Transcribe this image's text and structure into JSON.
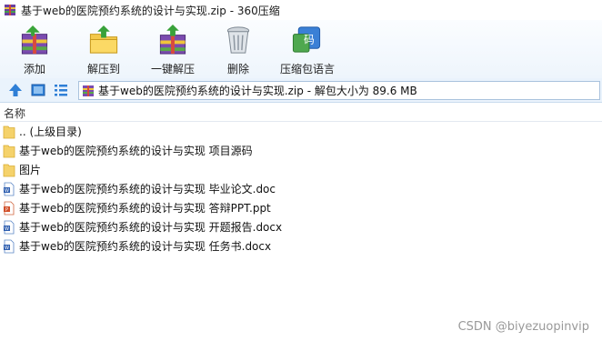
{
  "window": {
    "title": "基于web的医院预约系统的设计与实现.zip - 360压缩"
  },
  "toolbar": {
    "add": "添加",
    "extract_to": "解压到",
    "one_click_extract": "一键解压",
    "delete": "删除",
    "compress_language": "压缩包语言"
  },
  "address": {
    "path": "基于web的医院预约系统的设计与实现.zip - 解包大小为 89.6 MB"
  },
  "list": {
    "column_name": "名称",
    "items": [
      {
        "name": ".. (上级目录)",
        "type": "folder"
      },
      {
        "name": "基于web的医院预约系统的设计与实现 项目源码",
        "type": "folder"
      },
      {
        "name": "图片",
        "type": "folder"
      },
      {
        "name": "基于web的医院预约系统的设计与实现 毕业论文.doc",
        "type": "doc"
      },
      {
        "name": "基于web的医院预约系统的设计与实现 答辩PPT.ppt",
        "type": "ppt"
      },
      {
        "name": "基于web的医院预约系统的设计与实现 开题报告.docx",
        "type": "doc"
      },
      {
        "name": "基于web的医院预约系统的设计与实现 任务书.docx",
        "type": "doc"
      }
    ]
  },
  "watermark": "CSDN @biyezuopinvip"
}
